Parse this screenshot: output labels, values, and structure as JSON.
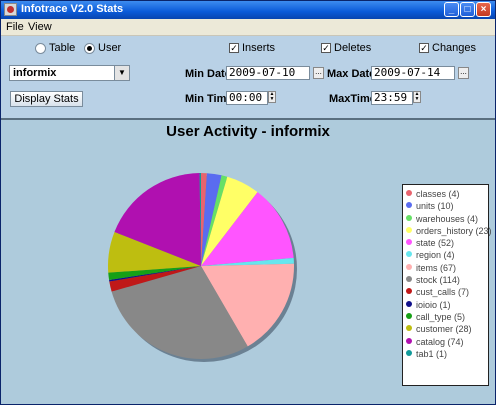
{
  "window": {
    "title": "Infotrace V2.0 Stats"
  },
  "menu": {
    "items": [
      "File",
      "View"
    ]
  },
  "controls": {
    "mode_options": [
      "Table",
      "User"
    ],
    "selected_mode": "User",
    "inserts_label": "Inserts",
    "deletes_label": "Deletes",
    "changes_label": "Changes",
    "user_select_value": "informix",
    "display_button": "Display Stats",
    "min_date_label": "Min Date",
    "min_date_value": "2009-07-10",
    "max_date_label": "Max Date",
    "max_date_value": "2009-07-14",
    "min_time_label": "Min Time",
    "min_time_value": "00:00",
    "max_time_label": "MaxTime",
    "max_time_value": "23:59"
  },
  "chart_data": {
    "type": "pie",
    "title": "User Activity -  informix",
    "slices": [
      {
        "label": "classes",
        "value": 4,
        "color": "#e8646e"
      },
      {
        "label": "units",
        "value": 10,
        "color": "#5a6cf0"
      },
      {
        "label": "warehouses",
        "value": 4,
        "color": "#66e066"
      },
      {
        "label": "orders_history",
        "value": 23,
        "color": "#ffff66"
      },
      {
        "label": "state",
        "value": 52,
        "color": "#ff55ff"
      },
      {
        "label": "region",
        "value": 4,
        "color": "#66e6ee"
      },
      {
        "label": "items",
        "value": 67,
        "color": "#ffb0b0"
      },
      {
        "label": "stock",
        "value": 114,
        "color": "#888888"
      },
      {
        "label": "cust_calls",
        "value": 7,
        "color": "#c01818"
      },
      {
        "label": "ioioio",
        "value": 1,
        "color": "#10108a"
      },
      {
        "label": "call_type",
        "value": 5,
        "color": "#16a016"
      },
      {
        "label": "customer",
        "value": 28,
        "color": "#bebe10"
      },
      {
        "label": "catalog",
        "value": 74,
        "color": "#b010b0"
      },
      {
        "label": "tab1",
        "value": 1,
        "color": "#109a9a"
      }
    ],
    "legend_position": "right"
  }
}
